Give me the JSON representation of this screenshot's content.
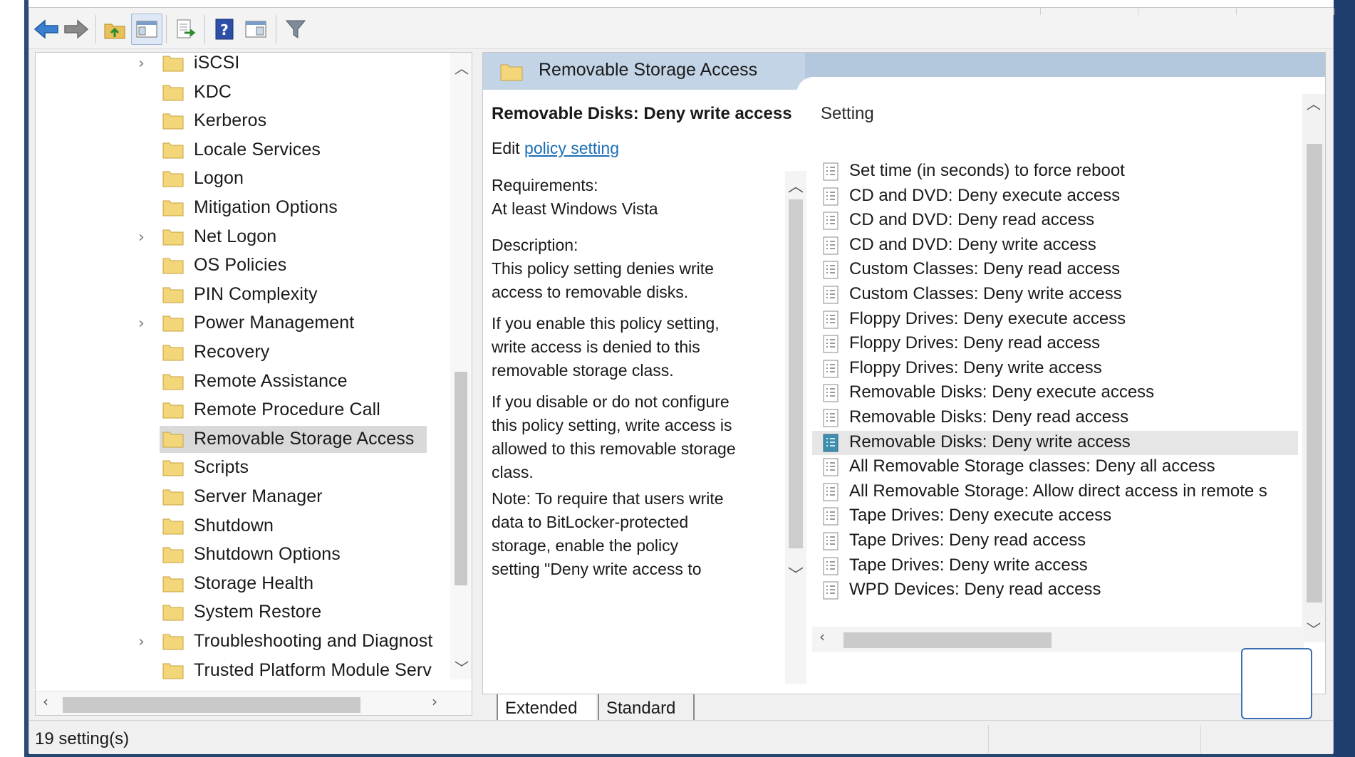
{
  "toolbar": {
    "buttons": [
      {
        "name": "back-button",
        "icon": "arrow-left-icon"
      },
      {
        "name": "forward-button",
        "icon": "arrow-right-icon"
      },
      {
        "name": "up-folder-button",
        "icon": "folder-up-icon"
      },
      {
        "name": "show-hide-tree-button",
        "icon": "console-tree-icon"
      },
      {
        "name": "export-list-button",
        "icon": "export-icon"
      },
      {
        "name": "help-button",
        "icon": "help-icon"
      },
      {
        "name": "properties-button",
        "icon": "window-icon"
      },
      {
        "name": "filter-button",
        "icon": "filter-icon"
      }
    ]
  },
  "tree": {
    "items": [
      {
        "label": "iSCSI",
        "expandable": true
      },
      {
        "label": "KDC",
        "expandable": false
      },
      {
        "label": "Kerberos",
        "expandable": false
      },
      {
        "label": "Locale Services",
        "expandable": false
      },
      {
        "label": "Logon",
        "expandable": false
      },
      {
        "label": "Mitigation Options",
        "expandable": false
      },
      {
        "label": "Net Logon",
        "expandable": true
      },
      {
        "label": "OS Policies",
        "expandable": false
      },
      {
        "label": "PIN Complexity",
        "expandable": false
      },
      {
        "label": "Power Management",
        "expandable": true
      },
      {
        "label": "Recovery",
        "expandable": false
      },
      {
        "label": "Remote Assistance",
        "expandable": false
      },
      {
        "label": "Remote Procedure Call",
        "expandable": false
      },
      {
        "label": "Removable Storage Access",
        "expandable": false,
        "selected": true
      },
      {
        "label": "Scripts",
        "expandable": false
      },
      {
        "label": "Server Manager",
        "expandable": false
      },
      {
        "label": "Shutdown",
        "expandable": false
      },
      {
        "label": "Shutdown Options",
        "expandable": false
      },
      {
        "label": "Storage Health",
        "expandable": false
      },
      {
        "label": "System Restore",
        "expandable": false
      },
      {
        "label": "Troubleshooting and Diagnost",
        "expandable": true
      },
      {
        "label": "Trusted Platform Module Serv",
        "expandable": false
      }
    ]
  },
  "details": {
    "header_title": "Removable Storage Access",
    "policy_title": "Removable Disks: Deny write access",
    "edit_prefix": "Edit ",
    "edit_link": "policy setting",
    "requirements_label": "Requirements:",
    "requirements_value": "At least Windows Vista",
    "description_label": "Description:",
    "description_p1": "This policy setting denies write access to removable disks.",
    "description_p2": "If you enable this policy setting, write access is denied to this removable storage class.",
    "description_p3": "If you disable or do not configure this policy setting, write access is allowed to this removable storage class.",
    "description_p4": "Note: To require that users write data to BitLocker-protected storage, enable the policy setting \"Deny write access to"
  },
  "settings": {
    "column_header": "Setting",
    "rows": [
      "Set time (in seconds) to force reboot",
      "CD and DVD: Deny execute access",
      "CD and DVD: Deny read access",
      "CD and DVD: Deny write access",
      "Custom Classes: Deny read access",
      "Custom Classes: Deny write access",
      "Floppy Drives: Deny execute access",
      "Floppy Drives: Deny read access",
      "Floppy Drives: Deny write access",
      "Removable Disks: Deny execute access",
      "Removable Disks: Deny read access",
      "Removable Disks: Deny write access",
      "All Removable Storage classes: Deny all access",
      "All Removable Storage: Allow direct access in remote s",
      "Tape Drives: Deny execute access",
      "Tape Drives: Deny read access",
      "Tape Drives: Deny write access",
      "WPD Devices: Deny read access"
    ],
    "selected_index": 11
  },
  "tabs": {
    "extended": "Extended",
    "standard": "Standard"
  },
  "status": {
    "count_text": "19 setting(s)"
  },
  "colors": {
    "folder": "#f3d57a",
    "link": "#1a6fb5",
    "header_band": "#b3c8dd",
    "selection": "#d9d9d9"
  }
}
